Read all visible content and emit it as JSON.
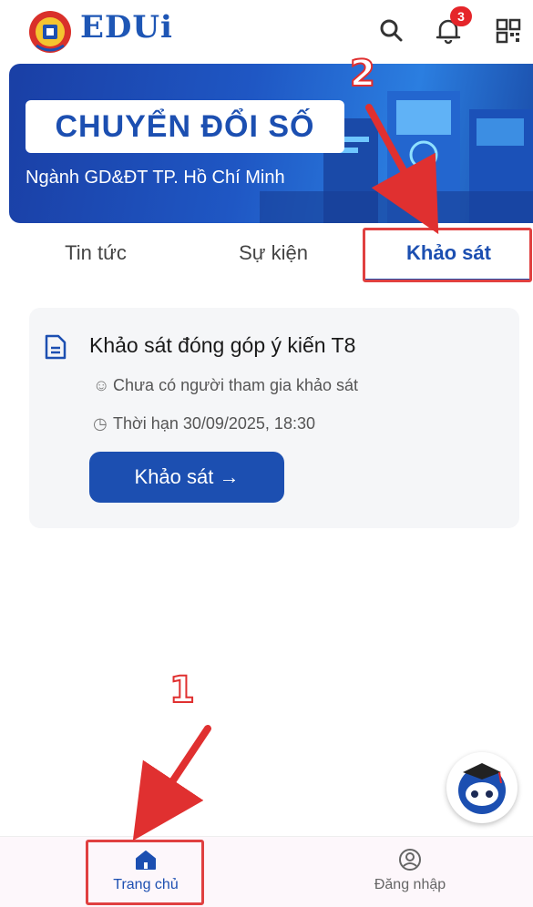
{
  "header": {
    "brand": "EDUi",
    "notification_count": "3"
  },
  "banner": {
    "title": "CHUYỂN ĐỔI SỐ",
    "subtitle": "Ngành GD&ĐT TP. Hồ Chí Minh"
  },
  "tabs": [
    {
      "label": "Tin tức",
      "active": false
    },
    {
      "label": "Sự kiện",
      "active": false
    },
    {
      "label": "Khảo sát",
      "active": true
    }
  ],
  "survey": {
    "title": "Khảo sát đóng góp ý kiến T8",
    "participants": "Chưa có người tham gia khảo sát",
    "deadline": "Thời hạn 30/09/2025, 18:30",
    "button_label": "Khảo sát →"
  },
  "bottom_nav": [
    {
      "label": "Trang chủ",
      "icon": "home-icon",
      "active": true
    },
    {
      "label": "Đăng nhập",
      "icon": "user-circle-icon",
      "active": false
    }
  ],
  "annotations": {
    "step1": "1",
    "step2": "2"
  },
  "colors": {
    "primary": "#1c4fb1",
    "highlight": "#e04040",
    "badge": "#e5252a"
  }
}
